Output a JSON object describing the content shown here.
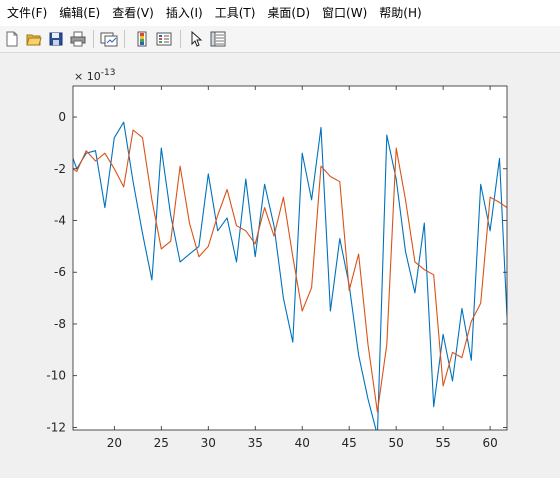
{
  "menu": {
    "items": [
      "文件(F)",
      "编辑(E)",
      "查看(V)",
      "插入(I)",
      "工具(T)",
      "桌面(D)",
      "窗口(W)",
      "帮助(H)"
    ]
  },
  "toolbar": {
    "buttons": [
      {
        "name": "new-figure-button",
        "icon": "new-document-icon"
      },
      {
        "name": "open-file-button",
        "icon": "folder-open-icon"
      },
      {
        "name": "save-button",
        "icon": "floppy-disk-icon"
      },
      {
        "name": "print-button",
        "icon": "printer-icon"
      },
      {
        "name": "link-plot-button",
        "icon": "link-plot-icon"
      },
      {
        "name": "insert-colorbar-button",
        "icon": "colorbar-icon"
      },
      {
        "name": "insert-legend-button",
        "icon": "legend-icon"
      },
      {
        "name": "edit-plot-button",
        "icon": "cursor-arrow-icon"
      },
      {
        "name": "property-inspector-button",
        "icon": "property-inspector-icon"
      }
    ]
  },
  "chart_data": {
    "type": "line",
    "title": "",
    "xlabel": "",
    "ylabel": "",
    "exponent_label": "× 10",
    "exponent_power": "-13",
    "xlim": [
      15.6,
      61.8
    ],
    "ylim": [
      -12.1,
      1.2
    ],
    "xticks": [
      20,
      25,
      30,
      35,
      40,
      45,
      50,
      55,
      60
    ],
    "yticks": [
      0,
      -2,
      -4,
      -6,
      -8,
      -10,
      -12
    ],
    "ytick_labels": [
      "0",
      "-2",
      "-4",
      "-6",
      "-8",
      "-10",
      "-12"
    ],
    "grid": false,
    "legend": "none",
    "x": [
      15.6,
      16,
      17,
      18,
      19,
      20,
      21,
      22,
      23,
      24,
      25,
      26,
      27,
      28,
      29,
      30,
      31,
      32,
      33,
      34,
      35,
      36,
      37,
      38,
      39,
      40,
      41,
      42,
      43,
      44,
      45,
      46,
      47,
      48,
      49,
      50,
      51,
      52,
      53,
      54,
      55,
      56,
      57,
      58,
      59,
      60,
      61,
      61.8
    ],
    "series": [
      {
        "color": "#0072BD",
        "values": [
          -1.6,
          -2.0,
          -1.4,
          -1.3,
          -3.5,
          -0.8,
          -0.2,
          -2.5,
          -4.5,
          -6.3,
          -1.2,
          -3.8,
          -5.6,
          -5.3,
          -5.0,
          -2.2,
          -4.4,
          -3.9,
          -5.6,
          -2.4,
          -5.4,
          -2.6,
          -4.2,
          -7.0,
          -8.7,
          -1.4,
          -3.2,
          -0.4,
          -7.5,
          -4.7,
          -6.5,
          -9.2,
          -10.9,
          -12.3,
          -0.7,
          -2.4,
          -5.2,
          -6.8,
          -4.1,
          -11.2,
          -8.4,
          -10.2,
          -7.4,
          -9.4,
          -2.6,
          -4.4,
          -1.6,
          -7.7
        ]
      },
      {
        "color": "#D95319",
        "values": [
          -2.0,
          -2.1,
          -1.3,
          -1.7,
          -1.4,
          -2.0,
          -2.7,
          -0.5,
          -0.8,
          -3.2,
          -5.1,
          -4.8,
          -1.9,
          -4.1,
          -5.4,
          -5.0,
          -3.8,
          -2.8,
          -4.2,
          -4.4,
          -4.9,
          -3.5,
          -4.6,
          -3.1,
          -5.4,
          -7.5,
          -6.6,
          -1.9,
          -2.3,
          -2.5,
          -6.7,
          -5.3,
          -8.8,
          -11.4,
          -8.8,
          -1.2,
          -3.2,
          -5.6,
          -5.9,
          -6.1,
          -10.4,
          -9.1,
          -9.3,
          -7.9,
          -7.2,
          -3.1,
          -3.3,
          -3.5
        ]
      }
    ]
  }
}
